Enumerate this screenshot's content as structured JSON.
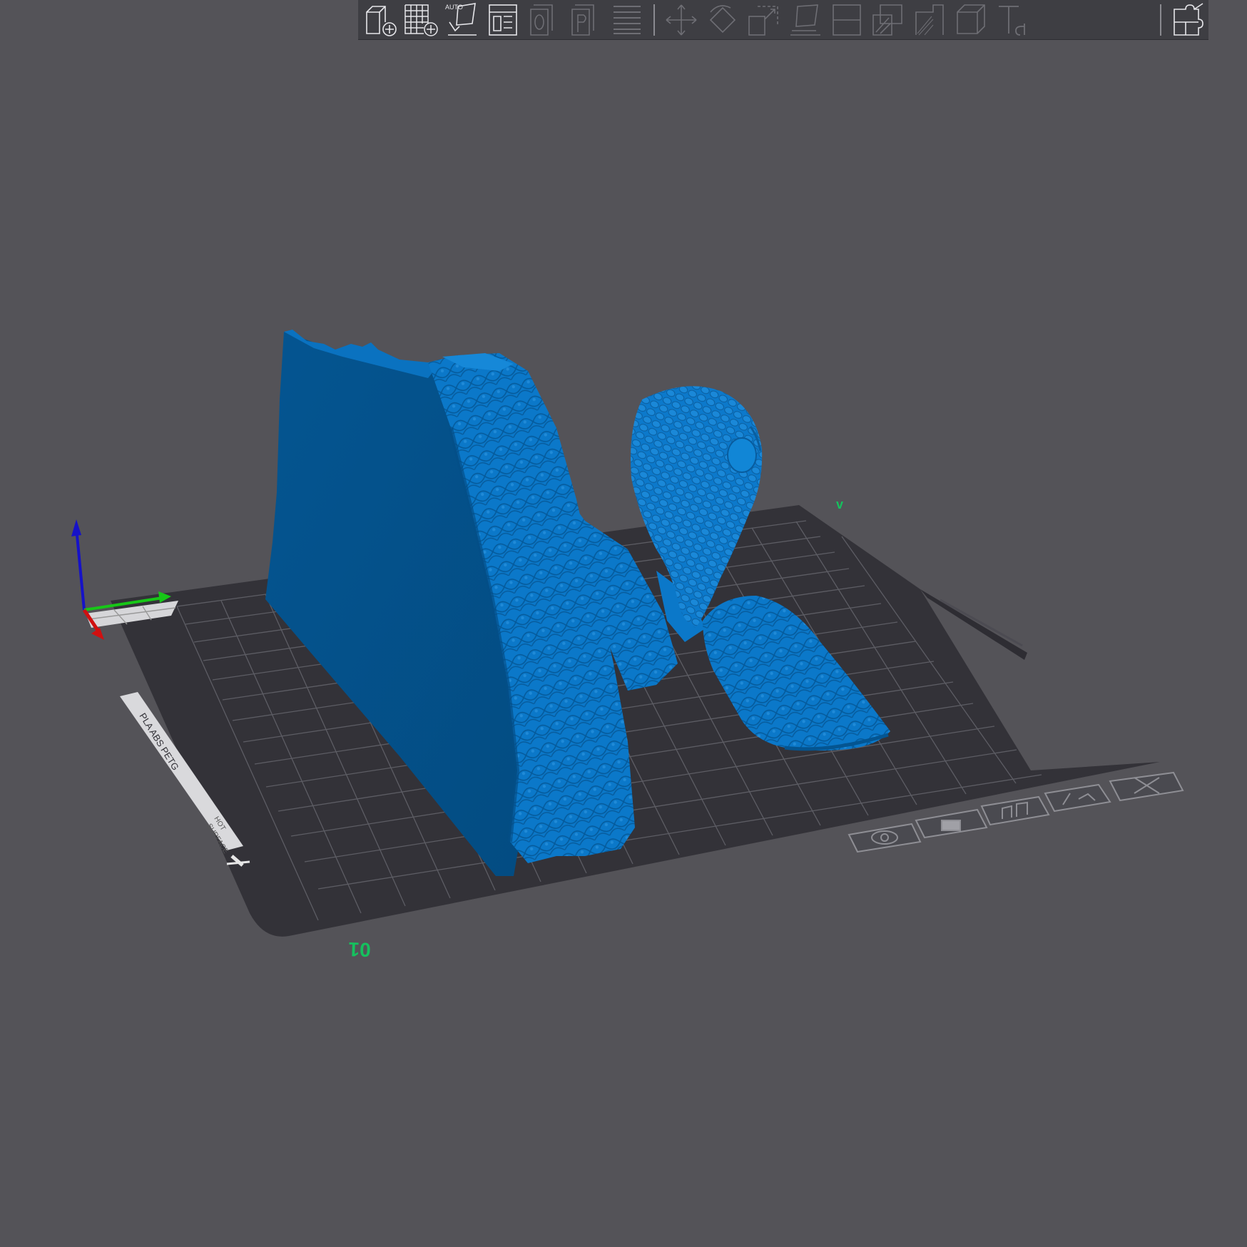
{
  "app": {
    "view": "3D view",
    "toolbar": {
      "buttons": [
        {
          "name": "add-object",
          "icon": "cube-add-icon",
          "enabled": true
        },
        {
          "name": "arrange-grid",
          "icon": "grid-add-icon",
          "enabled": true
        },
        {
          "name": "auto-orient",
          "icon": "auto-orient-icon",
          "label": "AUTO",
          "enabled": true
        },
        {
          "name": "layout",
          "icon": "layout-icon",
          "enabled": true
        },
        {
          "name": "copy",
          "icon": "copy-icon",
          "enabled": false
        },
        {
          "name": "paste",
          "icon": "paste-icon",
          "enabled": false
        },
        {
          "name": "layers",
          "icon": "layers-icon",
          "enabled": false
        },
        {
          "name": "move",
          "icon": "move-icon",
          "enabled": false
        },
        {
          "name": "rotate",
          "icon": "rotate-icon",
          "enabled": false
        },
        {
          "name": "scale",
          "icon": "scale-icon",
          "enabled": false
        },
        {
          "name": "place-on-face",
          "icon": "place-on-face-icon",
          "enabled": false
        },
        {
          "name": "cut",
          "icon": "cut-icon",
          "enabled": false
        },
        {
          "name": "paint-supports",
          "icon": "paint-supports-icon",
          "enabled": false
        },
        {
          "name": "seam-painting",
          "icon": "seam-icon",
          "enabled": false
        },
        {
          "name": "hollow",
          "icon": "hollow-icon",
          "enabled": false
        },
        {
          "name": "text",
          "icon": "text-icon",
          "enabled": false
        },
        {
          "name": "variable-layer-height",
          "icon": "puzzle-icon",
          "enabled": true
        }
      ]
    },
    "bed": {
      "sheet_label": "PLA ABS PETG",
      "hot_label_1": "HOT",
      "hot_label_2": "SURFACE",
      "near_marker": "01",
      "far_marker": "v",
      "grid_visible": true
    },
    "bed_buttons": [
      {
        "name": "bed-eye-button",
        "icon": "eye-icon"
      },
      {
        "name": "bed-lock-button",
        "icon": "lock-icon"
      },
      {
        "name": "bed-arrange-button",
        "icon": "bars-icon"
      },
      {
        "name": "bed-settings-button",
        "icon": "settings-icon"
      },
      {
        "name": "bed-close-button",
        "icon": "close-icon"
      }
    ],
    "colors": {
      "background": "#545358",
      "model": "#0A77C8",
      "model_shadow": "#03528E",
      "bed": "#333238",
      "grid": "#5d5d64",
      "axis_x": "#d01010",
      "axis_y": "#17c717",
      "axis_z": "#1612c8",
      "marker": "#15c15e"
    }
  }
}
